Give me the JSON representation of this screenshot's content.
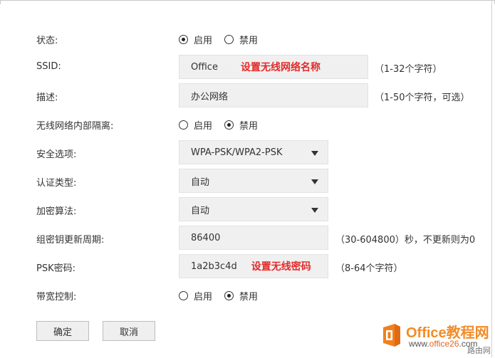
{
  "form": {
    "status": {
      "label": "状态:",
      "options": [
        "启用",
        "禁用"
      ],
      "selected": 0
    },
    "ssid": {
      "label": "SSID:",
      "value": "Office",
      "annotation": "设置无线网络名称",
      "hint": "（1-32个字符）"
    },
    "description": {
      "label": "描述:",
      "value": "办公网络",
      "hint": "（1-50个字符，可选）"
    },
    "isolation": {
      "label": "无线网络内部隔离:",
      "options": [
        "启用",
        "禁用"
      ],
      "selected": 1
    },
    "security": {
      "label": "安全选项:",
      "value": "WPA-PSK/WPA2-PSK"
    },
    "auth_type": {
      "label": "认证类型:",
      "value": "自动"
    },
    "encryption": {
      "label": "加密算法:",
      "value": "自动"
    },
    "group_key_period": {
      "label": "组密钥更新周期:",
      "value": "86400",
      "hint": "（30-604800）秒，不更新则为0"
    },
    "psk": {
      "label": "PSK密码:",
      "value": "1a2b3c4d",
      "annotation": "设置无线密码",
      "hint": "（8-64个字符）"
    },
    "bandwidth": {
      "label": "带宽控制:",
      "options": [
        "启用",
        "禁用"
      ],
      "selected": 1
    }
  },
  "buttons": {
    "confirm": "确定",
    "cancel": "取消"
  },
  "watermark": {
    "title": "Office教程网",
    "url_prefix": "www.",
    "url_main": "office26",
    "url_suffix": ".com",
    "corner": "路由网"
  },
  "colors": {
    "annotation": "#e32b2b",
    "field_bg": "#f0f0f0",
    "watermark_orange": "#f28c28"
  }
}
